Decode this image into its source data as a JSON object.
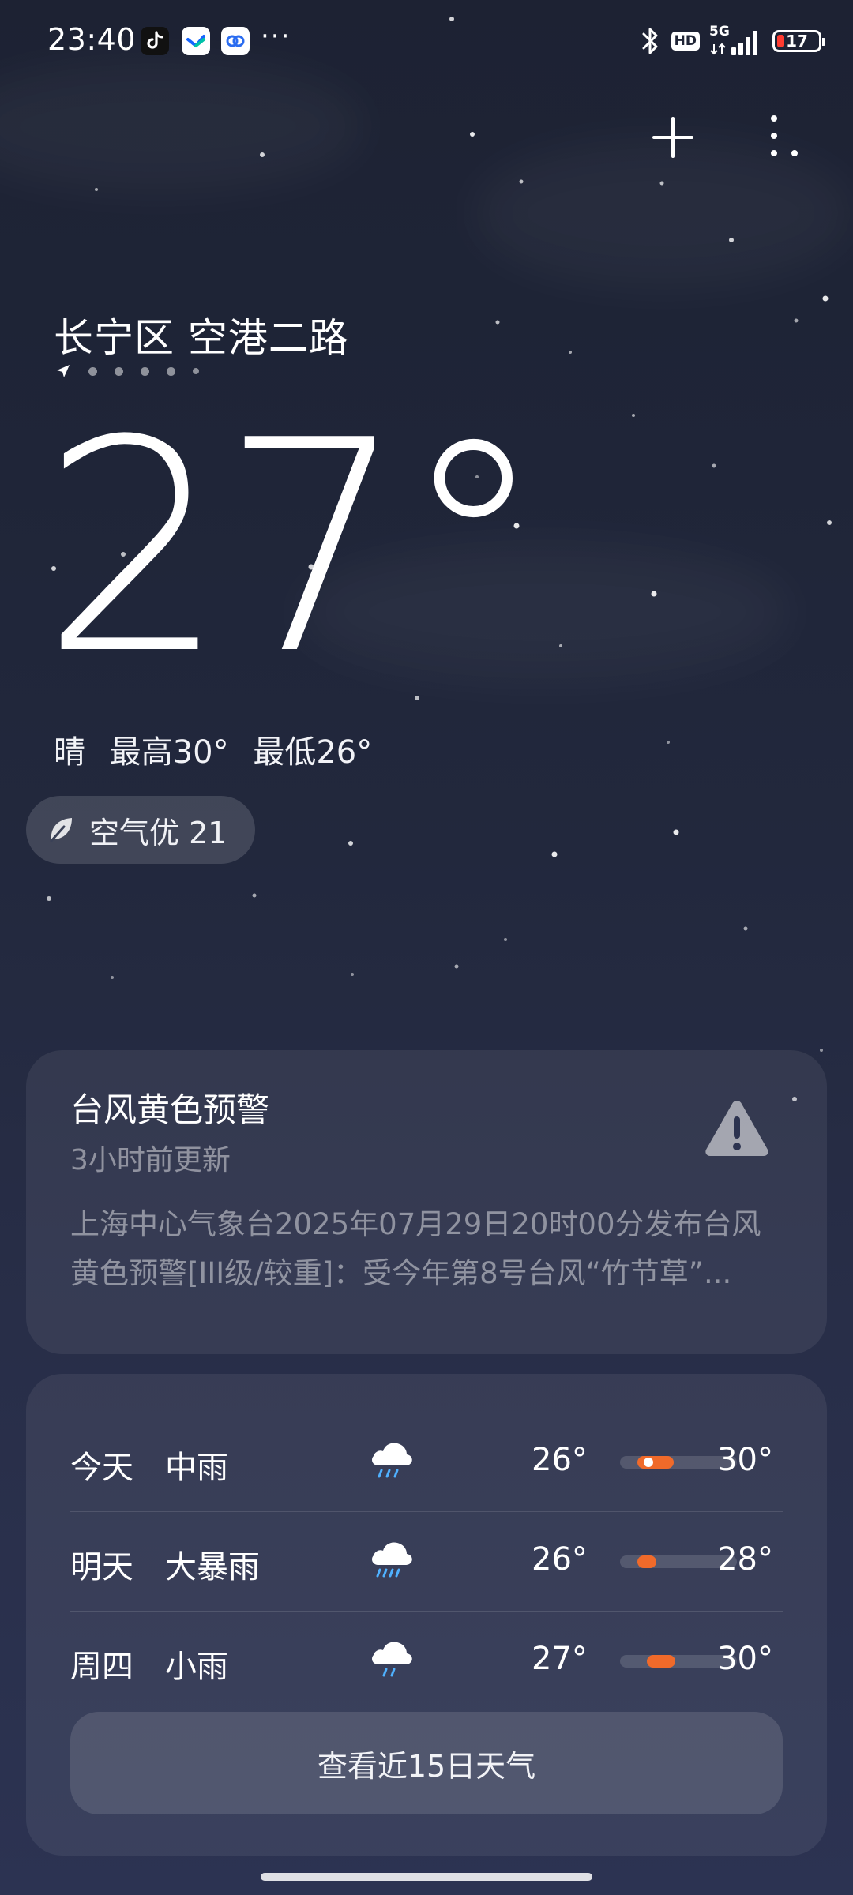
{
  "status_bar": {
    "time": "23:40",
    "notification_icons": [
      "tiktok-icon",
      "feishu-icon",
      "app-icon"
    ],
    "more": "···",
    "network": "5G",
    "hd": "HD",
    "battery": "17",
    "battery_color": "#ff3b30"
  },
  "header": {
    "location": "长宁区 空港二路"
  },
  "current": {
    "temperature": "27°",
    "condition": "晴",
    "high": "最高30°",
    "low": "最低26°",
    "aqi": "空气优 21"
  },
  "alert": {
    "title": "台风黄色预警",
    "updated": "3小时前更新",
    "body": "上海中心气象台2025年07月29日20时00分发布台风黄色预警[III级/较重]：受今年第8号台风“竹节草”..."
  },
  "forecast": {
    "days": [
      {
        "day": "今天",
        "condition": "中雨",
        "icon": "rain-cloud-icon",
        "low": "26°",
        "high": "30°"
      },
      {
        "day": "明天",
        "condition": "大暴雨",
        "icon": "rain-cloud-icon",
        "low": "26°",
        "high": "28°"
      },
      {
        "day": "周四",
        "condition": "小雨",
        "icon": "rain-cloud-icon",
        "low": "27°",
        "high": "30°"
      }
    ],
    "more_button": "查看近15日天气",
    "accent": "#f06a2a"
  }
}
